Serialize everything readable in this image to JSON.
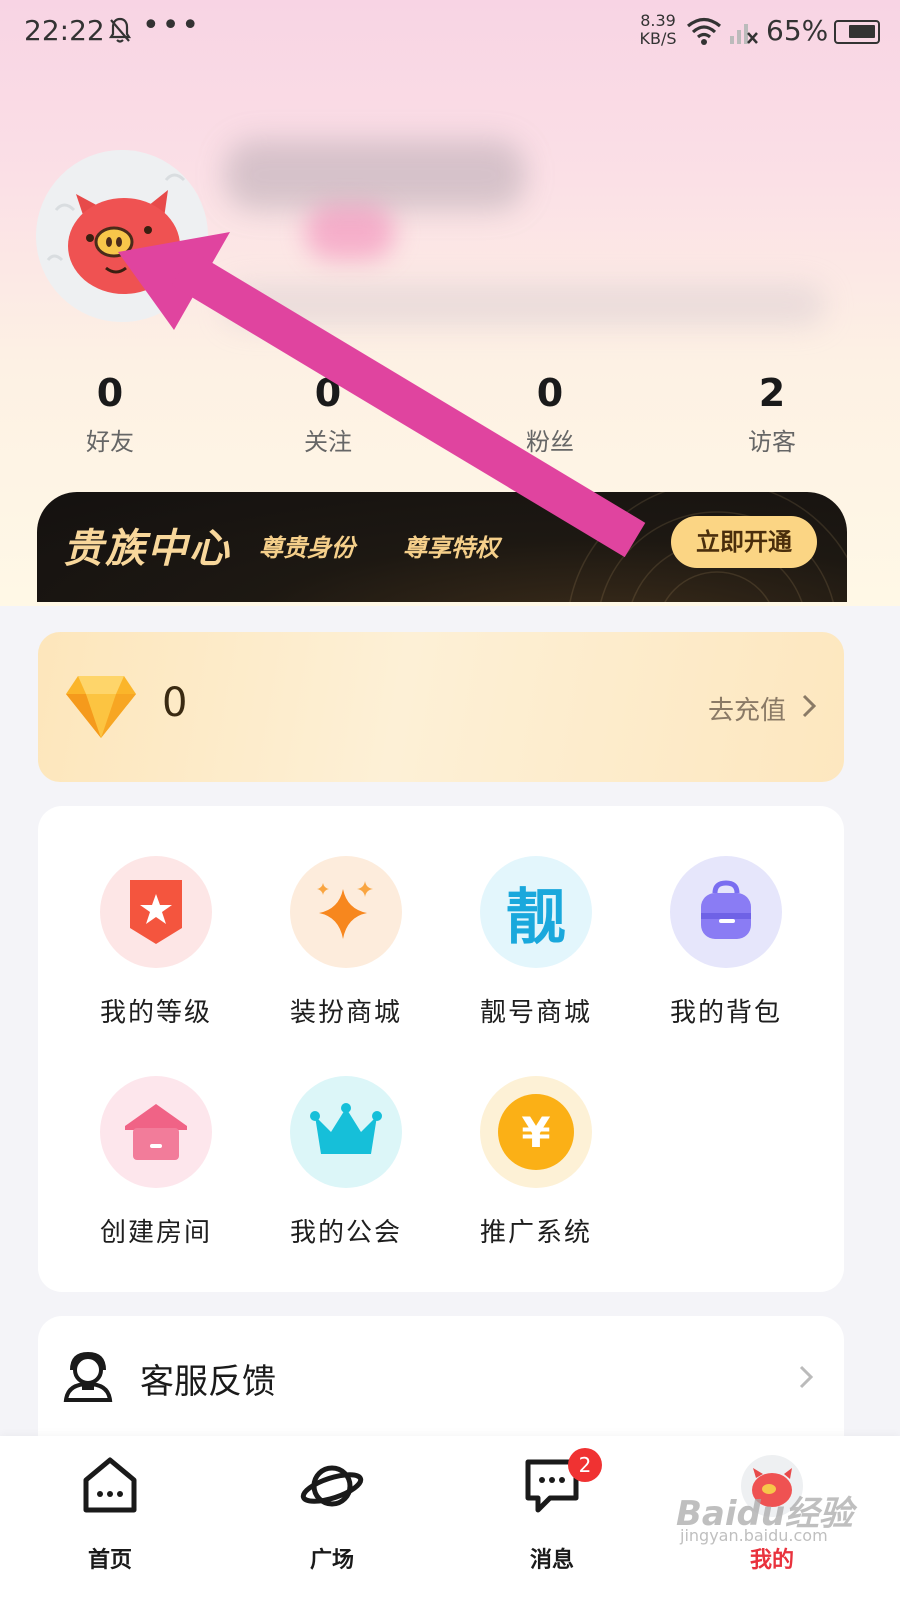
{
  "status_bar": {
    "time": "22:22",
    "dots": "•••",
    "speed_value": "8.39",
    "speed_unit": "KB/S",
    "battery": "65%"
  },
  "profile": {
    "stats": [
      {
        "value": "0",
        "label": "好友"
      },
      {
        "value": "0",
        "label": "关注"
      },
      {
        "value": "0",
        "label": "粉丝"
      },
      {
        "value": "2",
        "label": "访客"
      }
    ]
  },
  "vip": {
    "title": "贵族中心",
    "tag1": "尊贵身份",
    "tag2": "尊享特权",
    "button": "立即开通"
  },
  "wallet": {
    "diamond_count": "0",
    "recharge_label": "去充值"
  },
  "features": [
    {
      "label": "我的等级",
      "icon": "level-badge-icon"
    },
    {
      "label": "装扮商城",
      "icon": "sparkle-star-icon"
    },
    {
      "label": "靓号商城",
      "icon": "liang-char-icon",
      "icon_text": "靓"
    },
    {
      "label": "我的背包",
      "icon": "backpack-icon"
    },
    {
      "label": "创建房间",
      "icon": "house-icon"
    },
    {
      "label": "我的公会",
      "icon": "crown-icon"
    },
    {
      "label": "推广系统",
      "icon": "yuan-coin-icon",
      "icon_text": "¥"
    }
  ],
  "service": {
    "label": "客服反馈"
  },
  "nav": {
    "items": [
      {
        "label": "首页"
      },
      {
        "label": "广场"
      },
      {
        "label": "消息",
        "badge": "2"
      },
      {
        "label": "我的"
      }
    ]
  },
  "watermark": {
    "text": "Baidu经验",
    "sub": "jingyan.baidu.com"
  },
  "colors": {
    "accent_pink_arrow": "#e0449f",
    "vip_gold": "#f8d79b",
    "badge_red": "#f03232",
    "active_nav": "#e9323d"
  }
}
